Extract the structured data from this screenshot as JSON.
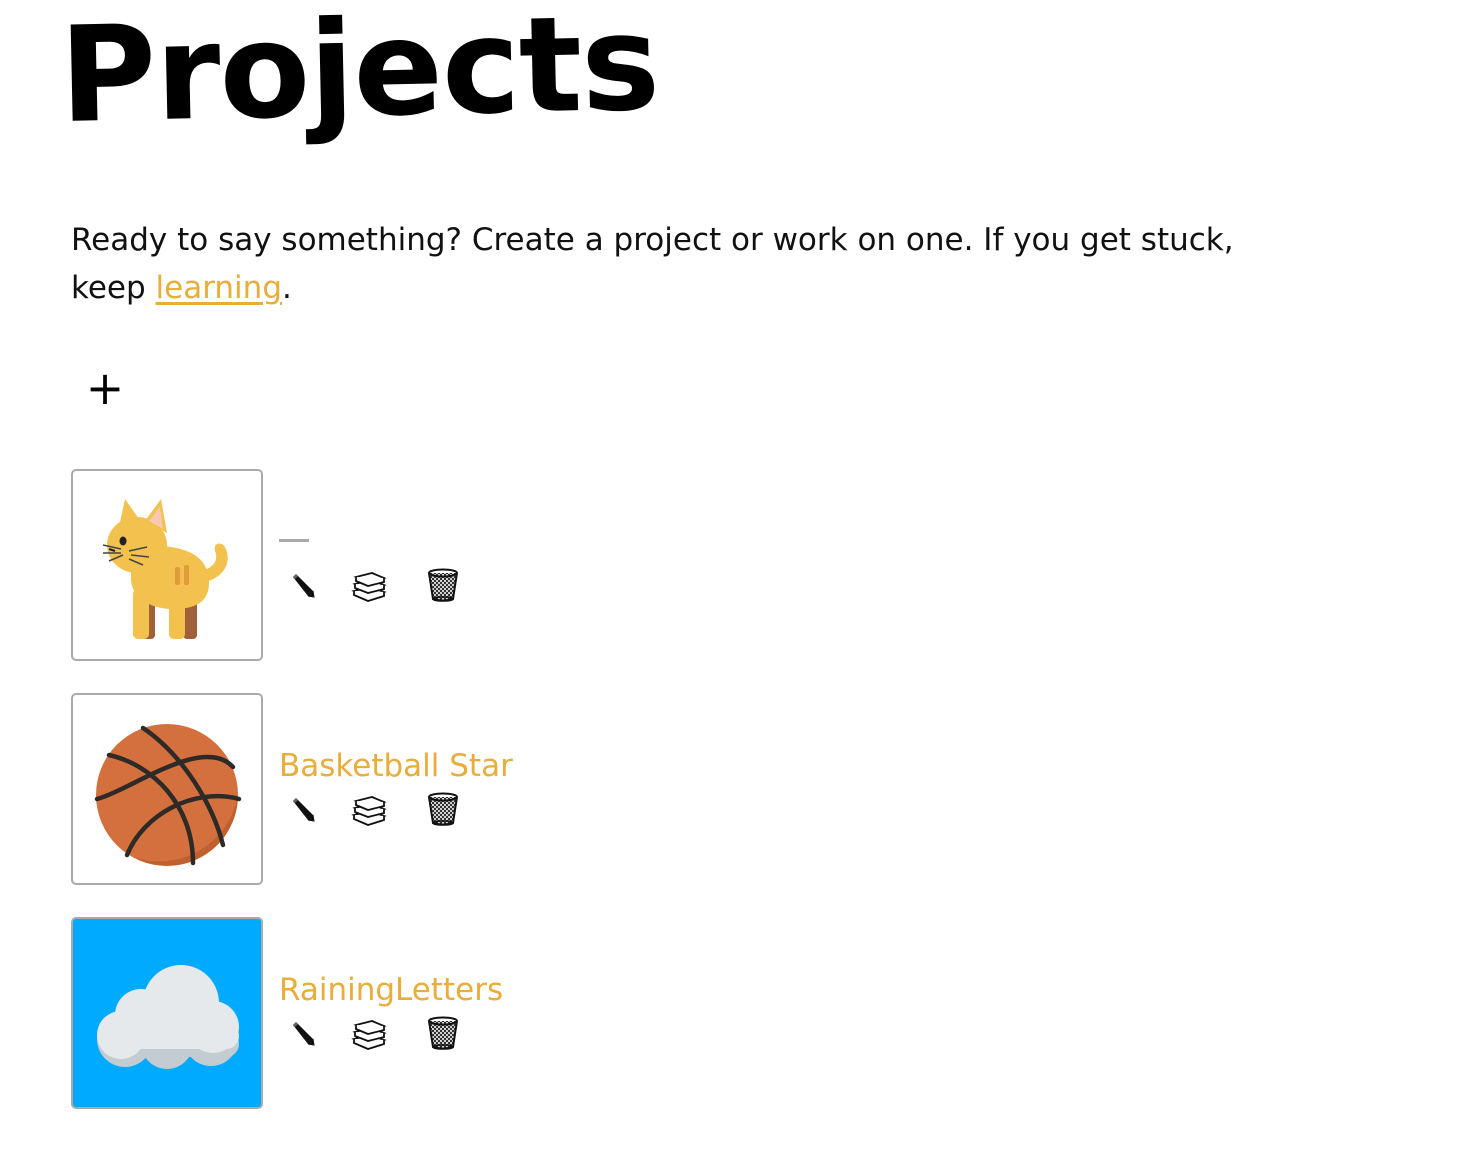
{
  "page": {
    "title": "Projects",
    "intro_text": "Ready to say something? Create a project or work on one. If you get stuck, keep ",
    "intro_link": "learning",
    "intro_end": ".",
    "add_button_label": "+"
  },
  "projects": [
    {
      "name": "",
      "thumbnail_icon": "cat-icon",
      "thumbnail_bg": "#ffffff"
    },
    {
      "name": "Basketball Star",
      "thumbnail_icon": "basketball-icon",
      "thumbnail_bg": "#ffffff"
    },
    {
      "name": "RainingLetters",
      "thumbnail_icon": "cloud-icon",
      "thumbnail_bg": "#00aaff"
    }
  ],
  "actions": [
    "pencil-icon",
    "books-icon",
    "trash-icon"
  ],
  "colors": {
    "accent": "#e8ad3a",
    "thumb_border": "#aaaaaa",
    "sky": "#00aaff"
  }
}
